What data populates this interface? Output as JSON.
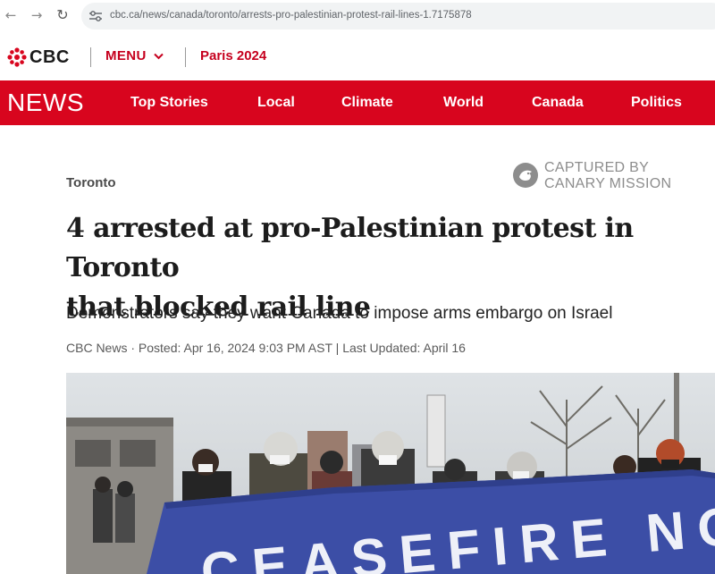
{
  "browser": {
    "url": "cbc.ca/news/canada/toronto/arrests-pro-palestinian-protest-rail-lines-1.7175878",
    "back_icon": "arrow-left-icon",
    "forward_icon": "arrow-right-icon",
    "reload_icon": "reload-icon"
  },
  "header": {
    "logo_text": "CBC",
    "menu_label": "MENU",
    "event_link": "Paris 2024"
  },
  "news_nav": {
    "section_title": "NEWS",
    "items": [
      "Top Stories",
      "Local",
      "Climate",
      "World",
      "Canada",
      "Politics"
    ]
  },
  "article": {
    "kicker": "Toronto",
    "headline_line1": "4 arrested at pro-Palestinian protest in Toronto",
    "headline_line2": "that blocked rail line",
    "deck": "Demonstrators say they want Canada to impose arms embargo on Israel",
    "byline": "CBC News · Posted: Apr 16, 2024 9:03 PM AST | Last Updated: April 16",
    "banner_text": "CEASEFIRE NOW"
  },
  "watermark": {
    "line1": "CAPTURED BY",
    "line2": "CANARY MISSION"
  },
  "colors": {
    "brand_red": "#d8051e",
    "menu_red": "#c6001e"
  }
}
